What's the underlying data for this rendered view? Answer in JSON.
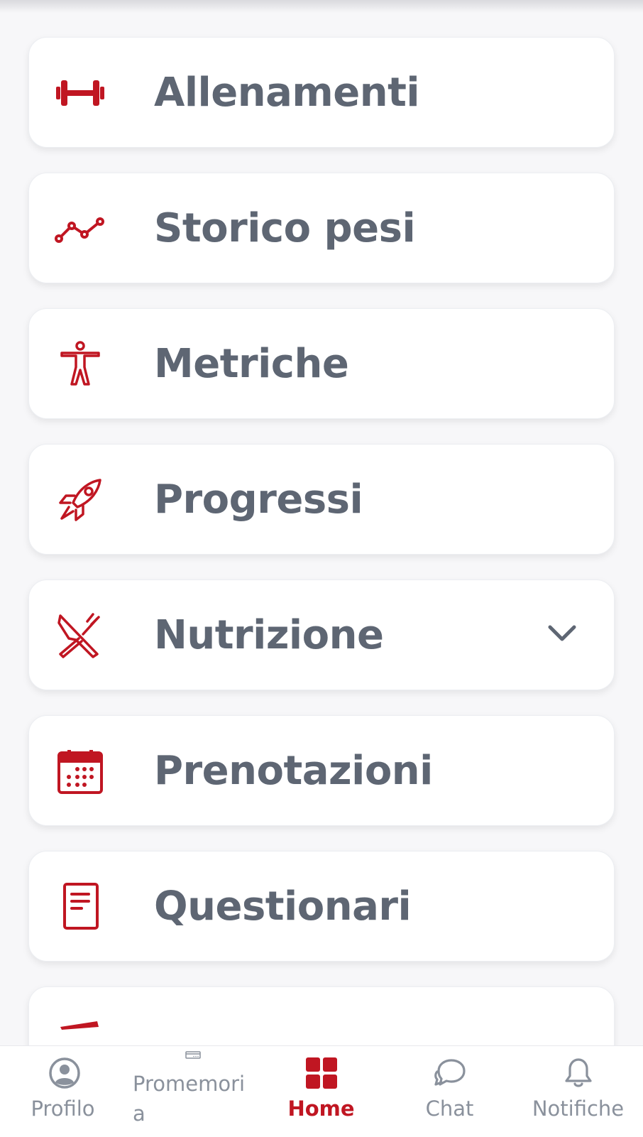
{
  "accent_color": "#c01622",
  "text_color": "#5e6673",
  "menu": {
    "items": [
      {
        "label": "Allenamenti",
        "icon": "dumbbell-icon"
      },
      {
        "label": "Storico pesi",
        "icon": "line-chart-icon"
      },
      {
        "label": "Metriche",
        "icon": "body-icon"
      },
      {
        "label": "Progressi",
        "icon": "rocket-icon"
      },
      {
        "label": "Nutrizione",
        "icon": "utensils-icon",
        "expandable": true
      },
      {
        "label": "Prenotazioni",
        "icon": "calendar-icon"
      },
      {
        "label": "Questionari",
        "icon": "document-icon"
      }
    ]
  },
  "nav": {
    "items": [
      {
        "label": "Profilo",
        "icon": "user-icon"
      },
      {
        "label": "Promemoria",
        "icon": "reminder-icon"
      },
      {
        "label": "Home",
        "icon": "grid-icon",
        "active": true
      },
      {
        "label": "Chat",
        "icon": "chat-icon"
      },
      {
        "label": "Notifiche",
        "icon": "bell-icon"
      }
    ]
  }
}
